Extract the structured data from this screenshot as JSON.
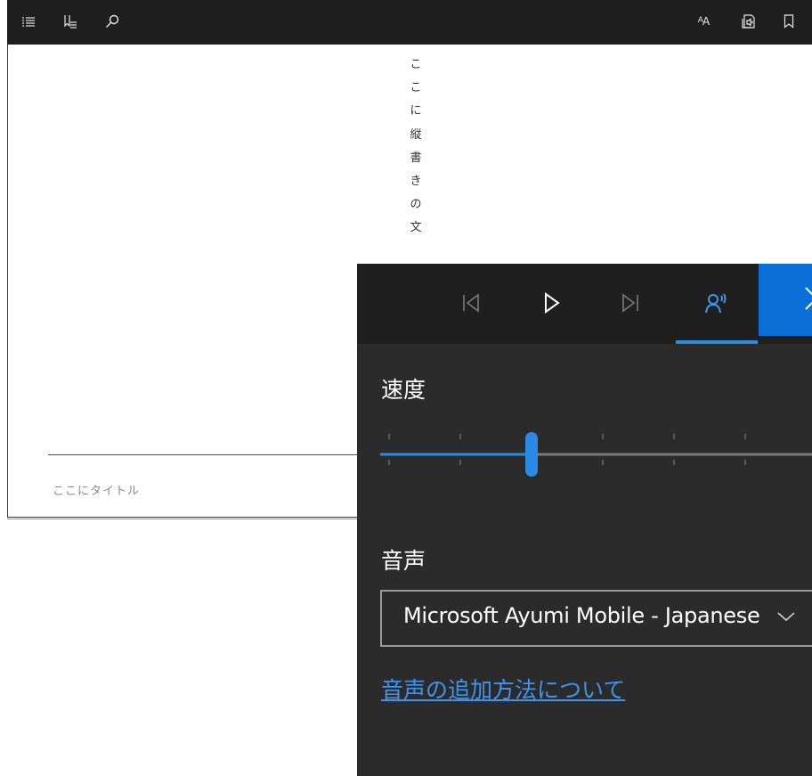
{
  "toolbar": {
    "buttons": [
      {
        "name": "table-of-contents",
        "icon": "list-icon"
      },
      {
        "name": "bookmarks-list",
        "icon": "bookmark-list-icon"
      },
      {
        "name": "search",
        "icon": "search-icon"
      },
      {
        "name": "text-options",
        "icon": "text-size-icon",
        "label_big": "A",
        "label_small": "A"
      },
      {
        "name": "read-aloud",
        "icon": "read-aloud-icon"
      },
      {
        "name": "add-bookmark",
        "icon": "bookmark-icon"
      }
    ]
  },
  "reader": {
    "vertical_text": [
      "こ",
      "こ",
      "に",
      "縦",
      "書",
      "き",
      "の",
      "文"
    ],
    "footer_title": "ここにタイトル"
  },
  "read_aloud": {
    "controls": {
      "previous": "previous-paragraph-icon",
      "play": "play-icon",
      "next": "next-paragraph-icon",
      "voice_settings": "voice-settings-icon",
      "close": "close-icon"
    },
    "speed": {
      "label": "速度",
      "level": 0.29
    },
    "voice": {
      "label": "音声",
      "selected": "Microsoft Ayumi Mobile - Japanese"
    },
    "add_voices_link": "音声の追加方法について"
  },
  "colors": {
    "toolbar_bg": "#1f1f1f",
    "panel_bg": "#2b2b2b",
    "panel_bar_bg": "#1f1f1f",
    "accent": "#0a6fd6",
    "link": "#3f94f0",
    "slider_track": "#7a7a7a"
  }
}
